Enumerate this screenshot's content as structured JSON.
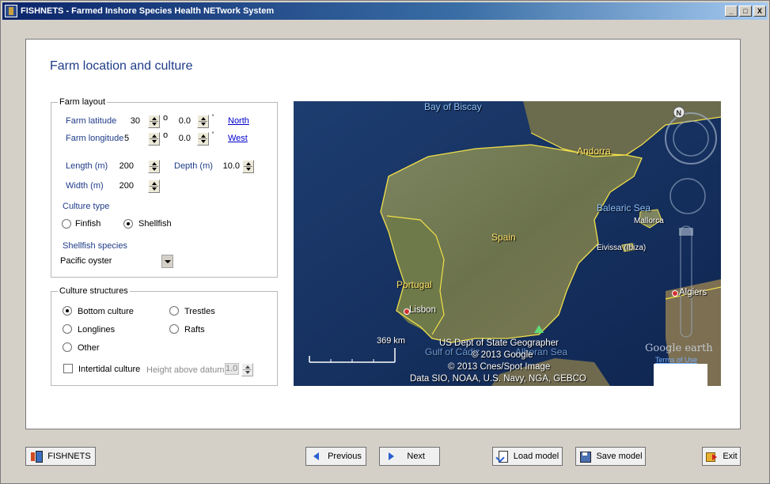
{
  "window": {
    "title": "FISHNETS - Farmed Inshore Species Health NETwork System",
    "controls": [
      "_",
      "□",
      "X"
    ]
  },
  "page": {
    "title": "Farm location and culture"
  },
  "farm_layout": {
    "label": "Farm layout",
    "latitude": {
      "label": "Farm latitude",
      "degrees": "30",
      "degree_sym": "o",
      "minutes": "0.0",
      "minute_sym": "'",
      "hemisphere": "North"
    },
    "longitude": {
      "label": "Farm longitude",
      "degrees": "5",
      "degree_sym": "o",
      "minutes": "0.0",
      "minute_sym": "'",
      "hemisphere": "West"
    },
    "length": {
      "label": "Length (m)",
      "value": "200"
    },
    "depth": {
      "label": "Depth (m)",
      "value": "10.0"
    },
    "width": {
      "label": "Width (m)",
      "value": "200"
    },
    "culture_type": {
      "label": "Culture type",
      "options": [
        "Finfish",
        "Shellfish"
      ],
      "selected": "Shellfish"
    },
    "shellfish_species": {
      "label": "Shellfish species",
      "value": "Pacific oyster"
    }
  },
  "culture_structures": {
    "label": "Culture structures",
    "options": [
      "Bottom culture",
      "Trestles",
      "Longlines",
      "Rafts",
      "Other"
    ],
    "selected": "Bottom culture",
    "intertidal": {
      "label": "Intertidal culture",
      "checked": false
    },
    "height_above_datum": {
      "label": "Height above datum",
      "value": "1.0"
    }
  },
  "map": {
    "labels": {
      "bay_of_biscay": "Bay of Biscay",
      "andorra": "Andorra",
      "balearic_sea": "Balearic Sea",
      "mallorca": "Mallorca",
      "eivissa": "Eivissa (Ibiza)",
      "spain": "Spain",
      "portugal": "Portugal",
      "lisbon": "Lisbon",
      "algiers": "Algiers",
      "gulf_of_cadiz": "Gulf of Cádiz",
      "alboran_sea": "Alboran Sea"
    },
    "scale": "369 km",
    "credits": [
      "US Dept of State Geographer",
      "© 2013 Google",
      "© 2013 Cnes/Spot Image",
      "Data SIO, NOAA, U.S. Navy, NGA, GEBCO"
    ],
    "compass_north": "N",
    "logo": "Google earth",
    "terms": "Terms of Use",
    "colors": {
      "sea": "#16305e",
      "land": "#6e7750",
      "border": "#f2e14a"
    }
  },
  "footer": {
    "fishnets": "FISHNETS",
    "previous": "Previous",
    "next": "Next",
    "load": "Load model",
    "save": "Save model",
    "exit": "Exit"
  }
}
